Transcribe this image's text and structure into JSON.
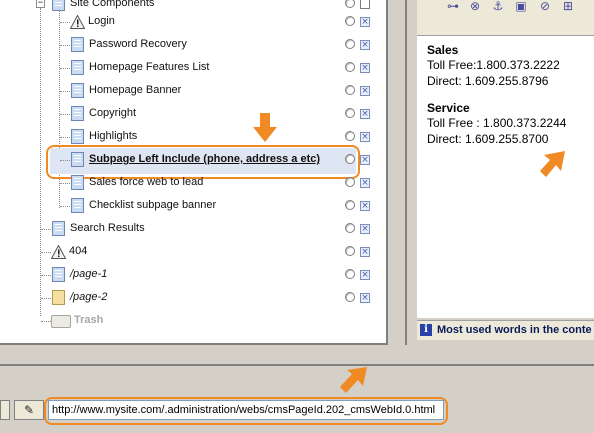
{
  "tree": {
    "root_label": "Site Components",
    "items": [
      {
        "label": "Login",
        "icon": "warning-icon"
      },
      {
        "label": "Password Recovery",
        "icon": "page-icon"
      },
      {
        "label": "Homepage Features List",
        "icon": "page-icon"
      },
      {
        "label": "Homepage Banner",
        "icon": "page-icon"
      },
      {
        "label": "Copyright",
        "icon": "page-icon"
      },
      {
        "label": "Highlights",
        "icon": "page-icon"
      },
      {
        "label": "Subpage Left Include (phone, address a etc)",
        "icon": "page-icon",
        "selected": true
      },
      {
        "label": "Sales force web to lead",
        "icon": "page-icon"
      },
      {
        "label": "Checklist subpage banner",
        "icon": "page-icon"
      }
    ],
    "top_items": [
      {
        "label": "Search Results",
        "icon": "page-icon"
      },
      {
        "label": "404",
        "icon": "warning-icon"
      },
      {
        "label": "/page-1",
        "icon": "page-icon"
      },
      {
        "label": "/page-2",
        "icon": "draft-page-icon"
      },
      {
        "label": "Trash",
        "icon": "trash-icon"
      }
    ]
  },
  "preview": {
    "sales_heading": "Sales",
    "sales_toll": "Toll Free:1.800.373.2222",
    "sales_direct": "Direct: 1.609.255.8796",
    "service_heading": "Service",
    "service_toll": "Toll Free : 1.800.373.2244",
    "service_direct": "Direct: 1.609.255.8700",
    "status_text": "Most used words in the conte"
  },
  "address_bar": {
    "url": "http://www.mysite.com/.administration/webs/cmsPageId.202_cmsWebId.0.html"
  },
  "colors": {
    "highlight": "#f08a24",
    "selection": "#dfe6f3"
  }
}
